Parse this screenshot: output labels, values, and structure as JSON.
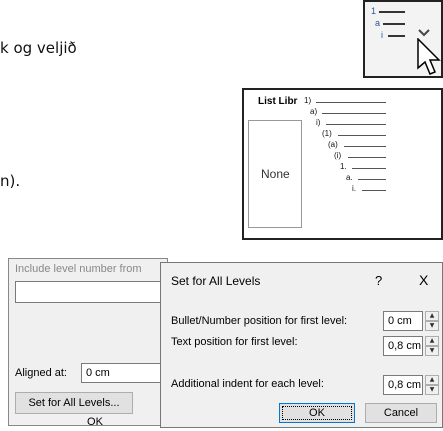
{
  "body_text": {
    "line1": "k og veljið",
    "line2": "n)."
  },
  "ribbon_button": {
    "icon": "multilevel-list-icon",
    "num1": "1",
    "num2": "a",
    "num3": "i",
    "dropdown_icon": "chevron-down-icon",
    "cursor_icon": "mouse-pointer-icon"
  },
  "list_library": {
    "title": "List Libr",
    "none_label": "None",
    "levels": [
      "1)",
      "a)",
      "i)",
      "(1)",
      "(a)",
      "(i)",
      "1.",
      "a.",
      "i."
    ]
  },
  "bg_dialog": {
    "include_level_label": "Include level number from",
    "aligned_at_label": "Aligned at:",
    "aligned_at_value": "0 cm",
    "set_all_levels_label": "Set for All Levels...",
    "ok_label": "OK"
  },
  "set_all_levels_dialog": {
    "title": "Set for All Levels",
    "help": "?",
    "close": "X",
    "bullet_position_label": "Bullet/Number position for first level:",
    "bullet_position_value": "0 cm",
    "text_position_label": "Text position for first level:",
    "text_position_value": "0,8 cm",
    "additional_indent_label": "Additional indent for each level:",
    "additional_indent_value": "0,8 cm",
    "ok_label": "OK",
    "cancel_label": "Cancel"
  }
}
